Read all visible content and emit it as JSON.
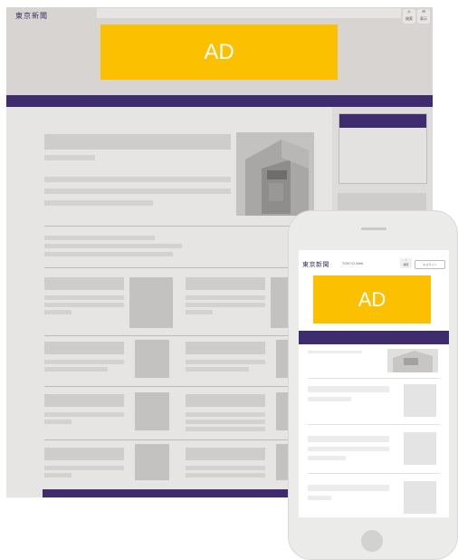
{
  "desktop": {
    "logo": "東京新聞",
    "header_buttons": [
      {
        "icon": "search-icon",
        "glyph": "⌕",
        "label": "検索"
      },
      {
        "icon": "menu-icon",
        "glyph": "≡",
        "label": "表示"
      }
    ],
    "ad_label": "AD",
    "brand_color": "#3e2c6e",
    "ad_color": "#fbc000"
  },
  "mobile": {
    "logo": "東京新聞",
    "subtitle": "TOKYO Web",
    "header_buttons": [
      {
        "icon": "search-icon",
        "glyph": "⌕",
        "label": "検索"
      },
      {
        "icon": "menu-icon",
        "glyph": "≡",
        "label": "表示"
      }
    ],
    "login_label": "ログイン",
    "ad_label": "AD"
  }
}
